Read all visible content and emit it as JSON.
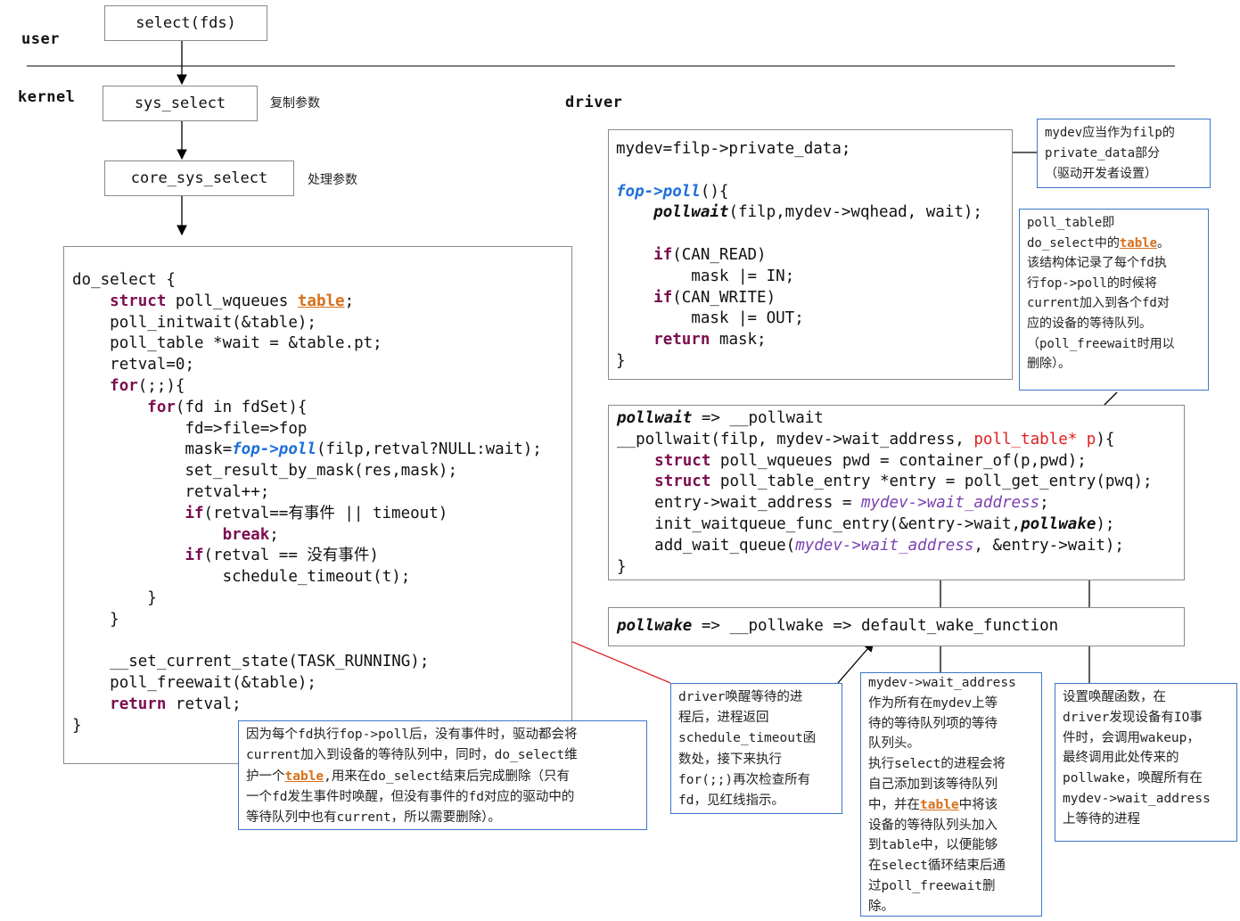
{
  "labels": {
    "user": "user",
    "kernel": "kernel",
    "driver": "driver"
  },
  "flow": {
    "select": "select(fds)",
    "sys_select": "sys_select",
    "sys_select_note": "复制参数",
    "core_sys_select": "core_sys_select",
    "core_sys_select_note": "处理参数"
  },
  "do_select": {
    "l1": "do_select {",
    "l2_kw": "struct",
    "l2_a": " poll_wqueues ",
    "l2_tb": "table",
    "l2_b": ";",
    "l3": "poll_initwait(&table);",
    "l4": "poll_table *wait = &table.pt;",
    "l5": "retval=0;",
    "l6_kw": "for",
    "l6": "(;;){",
    "l7_kw": "for",
    "l7": "(fd in fdSet){",
    "l8": "fd=>file=>fop",
    "l9_a": "mask=",
    "l9_fn": "fop->poll",
    "l9_b": "(filp,retval?NULL:wait);",
    "l10": "set_result_by_mask(res,mask);",
    "l11": "retval++;",
    "l12_kw": "if",
    "l12": "(retval==有事件 || timeout)",
    "l13_kw": "break",
    "l13": ";",
    "l14_kw": "if",
    "l14": "(retval == 没有事件)",
    "l15": "schedule_timeout(t);",
    "l16": "}",
    "l17": "}",
    "l18": "__set_current_state(TASK_RUNNING);",
    "l19": "poll_freewait(&table);",
    "l20_kw": "return",
    "l20": " retval;",
    "l21": "}"
  },
  "fop_poll": {
    "l1": "mydev=filp->private_data;",
    "l2_fn": "fop->poll",
    "l2": "(){",
    "l3_bi": "pollwait",
    "l3": "(filp,mydev->wqhead, wait);",
    "l4_kw": "if",
    "l4": "(CAN_READ)",
    "l5": "mask |= IN;",
    "l6_kw": "if",
    "l6": "(CAN_WRITE)",
    "l7": "mask |= OUT;",
    "l8_kw": "return",
    "l8": " mask;",
    "l9": "}"
  },
  "pollwait": {
    "l1_bi": "pollwait",
    "l1": " => __pollwait",
    "l2_a": "__pollwait(filp, mydev->wait_address, ",
    "l2_rd": "poll_table* p",
    "l2_b": "){",
    "l3_kw": "struct",
    "l3": " poll_wqueues pwd = container_of(p,pwd);",
    "l4_kw": "struct",
    "l4": " poll_table_entry *entry = poll_get_entry(pwq);",
    "l5_a": "entry->wait_address = ",
    "l5_pu": "mydev->wait_address",
    "l5_b": ";",
    "l6_a": "init_waitqueue_func_entry(&entry->wait,",
    "l6_bi": "pollwake",
    "l6_b": ");",
    "l7_a": "add_wait_queue(",
    "l7_pu": "mydev->wait_address",
    "l7_b": ", &entry->wait);",
    "l8": "}"
  },
  "pollwake": {
    "bi": "pollwake",
    "rest": " => __pollwake => default_wake_function"
  },
  "notes": {
    "private_data": "mydev应当作为filp的\nprivate_data部分\n（驱动开发者设置）",
    "poll_table_a": "poll_table即\ndo_select中的",
    "poll_table_tb": "table",
    "poll_table_b": "。\n该结构体记录了每个fd执\n行fop->poll的时候将\ncurrent加入到各个fd对\n应的设备的等待队列。\n（poll_freewait时用以\n删除）。",
    "freewait_a": "因为每个fd执行fop->poll后，没有事件时，驱动都会将\ncurrent加入到设备的等待队列中，同时，do_select维\n护一个",
    "freewait_tb": "table",
    "freewait_b": ",用来在do_select结束后完成删除（只有\n一个fd发生事件时唤醒，但没有事件的fd对应的驱动中的\n等待队列中也有current，所以需要删除）。",
    "wake_back": "driver唤醒等待的进\n程后，进程返回\nschedule_timeout函\n数处，接下来执行\nfor(;;)再次检查所有\nfd，见红线指示。",
    "wait_address_a": "mydev->wait_address\n作为所有在mydev上等\n待的等待队列项的等待\n队列头。\n执行select的进程会将\n自己添加到该等待队列\n中，并在",
    "wait_address_tb": "table",
    "wait_address_b": "中将该\n设备的等待队列头加入\n到table中，以便能够\n在select循环结束后通\n过poll_freewait删\n除。",
    "wakeup_fn": "设置唤醒函数，在\ndriver发现设备有IO事\n件时，会调用wakeup，\n最终调用此处传来的\npollwake，唤醒所有在\nmydev->wait_address\n上等待的进程"
  }
}
